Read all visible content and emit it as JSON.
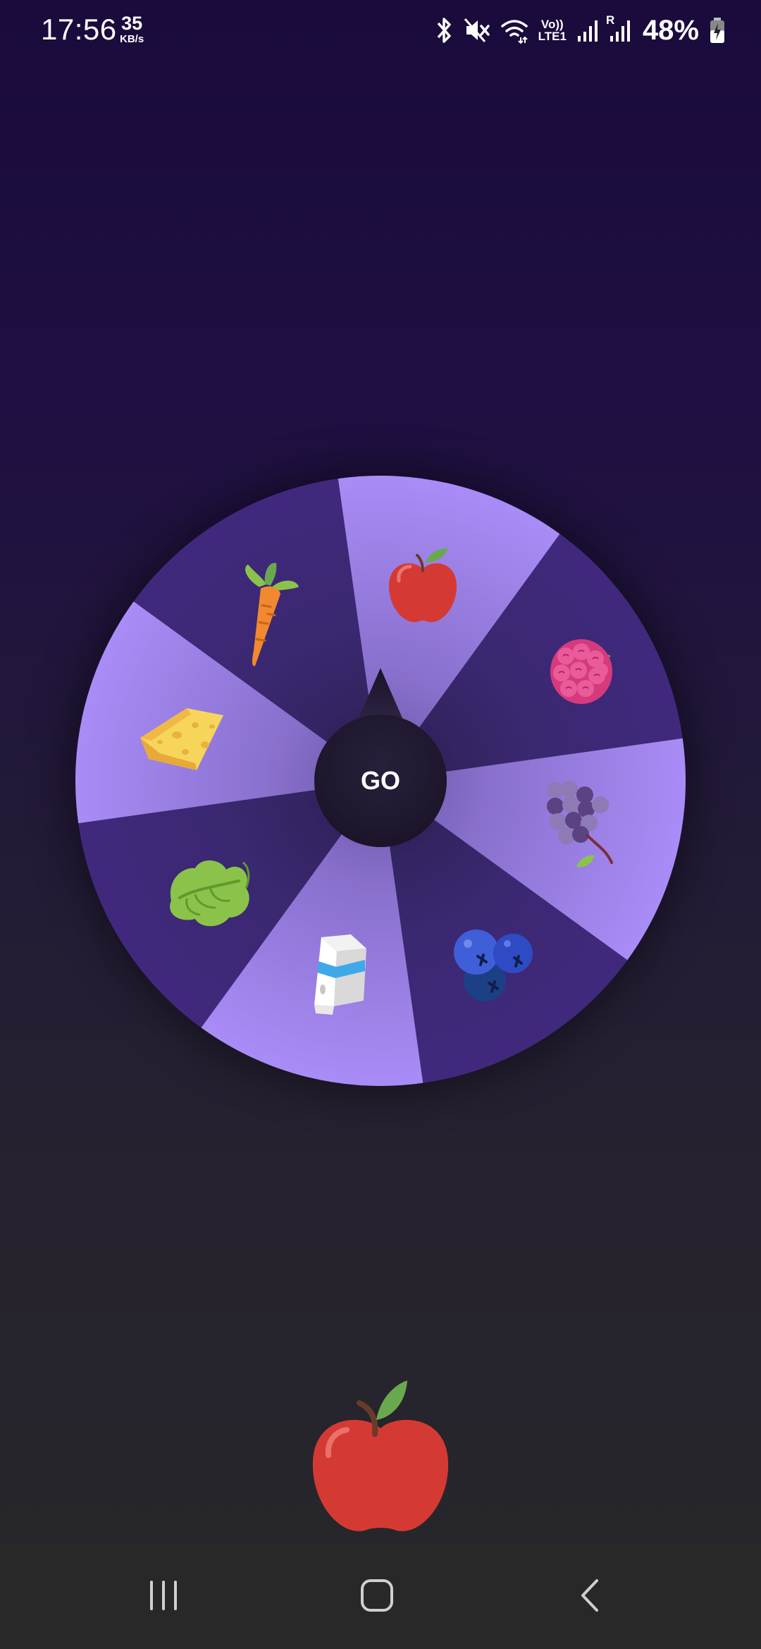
{
  "status_bar": {
    "time": "17:56",
    "net_speed_value": "35",
    "net_speed_unit": "KB/s",
    "volte_label": "Vo))",
    "lte_label": "LTE1",
    "roaming_label": "R",
    "battery_percent": "48%",
    "icons": [
      "bluetooth-icon",
      "mute-icon",
      "wifi-icon",
      "signal-icon",
      "signal-roaming-icon",
      "battery-charging-icon"
    ]
  },
  "wheel": {
    "button_label": "GO",
    "segments": [
      {
        "item": "apple",
        "icon": "apple-icon",
        "style": "light"
      },
      {
        "item": "raspberry",
        "icon": "raspberry-icon",
        "style": "dark"
      },
      {
        "item": "grapes",
        "icon": "grapes-icon",
        "style": "light"
      },
      {
        "item": "blueberries",
        "icon": "blueberries-icon",
        "style": "dark"
      },
      {
        "item": "milk",
        "icon": "milk-carton-icon",
        "style": "light"
      },
      {
        "item": "lettuce",
        "icon": "lettuce-icon",
        "style": "dark"
      },
      {
        "item": "cheese",
        "icon": "cheese-icon",
        "style": "light"
      },
      {
        "item": "carrot",
        "icon": "carrot-icon",
        "style": "dark"
      }
    ]
  },
  "result": {
    "item": "apple",
    "icon": "apple-icon"
  },
  "nav_bar": {
    "buttons": [
      "recents-button",
      "home-button",
      "back-button"
    ]
  },
  "colors": {
    "segment_light": "#a58af5",
    "segment_dark": "#3f2a7a",
    "hub": "#1c1529",
    "apple_red": "#d43a33",
    "leaf_green": "#6aa84f"
  }
}
